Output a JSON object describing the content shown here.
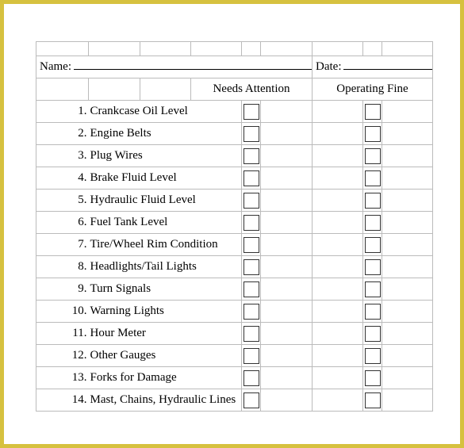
{
  "form": {
    "name_label": "Name:",
    "date_label": "Date:",
    "headers": {
      "needs_attention": "Needs Attention",
      "operating_fine": "Operating Fine"
    },
    "items": [
      {
        "num": "1.",
        "label": "Crankcase Oil Level"
      },
      {
        "num": "2.",
        "label": "Engine Belts"
      },
      {
        "num": "3.",
        "label": "Plug Wires"
      },
      {
        "num": "4.",
        "label": "Brake Fluid Level"
      },
      {
        "num": "5.",
        "label": "Hydraulic Fluid Level"
      },
      {
        "num": "6.",
        "label": "Fuel Tank Level"
      },
      {
        "num": "7.",
        "label": "Tire/Wheel Rim Condition"
      },
      {
        "num": "8.",
        "label": "Headlights/Tail Lights"
      },
      {
        "num": "9.",
        "label": "Turn Signals"
      },
      {
        "num": "10.",
        "label": "Warning Lights"
      },
      {
        "num": "11.",
        "label": "Hour Meter"
      },
      {
        "num": "12.",
        "label": "Other Gauges"
      },
      {
        "num": "13.",
        "label": "Forks for Damage"
      },
      {
        "num": "14.",
        "label": "Mast, Chains, Hydraulic Lines"
      }
    ]
  }
}
